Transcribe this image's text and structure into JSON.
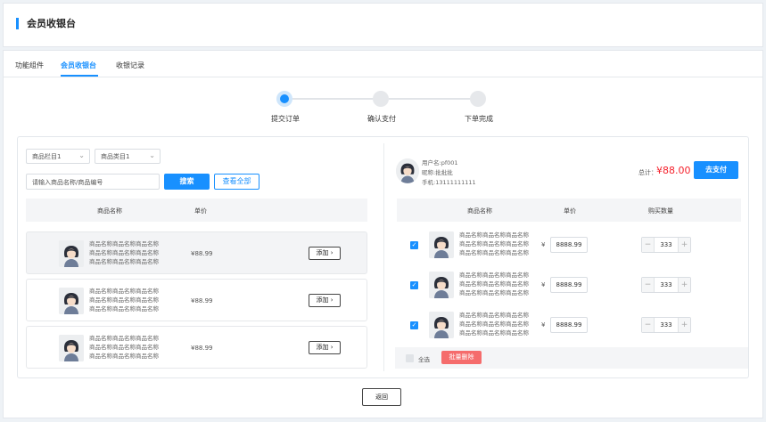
{
  "page": {
    "title": "会员收银台"
  },
  "tabs": [
    {
      "label": "功能组件"
    },
    {
      "label": "会员收银台"
    },
    {
      "label": "收银记录"
    }
  ],
  "steps": [
    {
      "label": "提交订单",
      "active": true
    },
    {
      "label": "确认支付",
      "active": false
    },
    {
      "label": "下单完成",
      "active": false
    }
  ],
  "filters": {
    "column_select": "商品栏目1",
    "category_select": "商品类目1",
    "search_placeholder": "请输入商品名称/商品编号",
    "search_label": "搜索",
    "view_all_label": "查看全部"
  },
  "product_table": {
    "headers": [
      "商品名称",
      "单价"
    ],
    "rows": [
      {
        "name": "商品名称商品名称商品名称商品名称商品名称商品名称商品名称商品名称商品名称",
        "price": "¥88.99",
        "add_label": "添加"
      },
      {
        "name": "商品名称商品名称商品名称商品名称商品名称商品名称商品名称商品名称商品名称",
        "price": "¥88.99",
        "add_label": "添加"
      },
      {
        "name": "商品名称商品名称商品名称商品名称商品名称商品名称商品名称商品名称商品名称",
        "price": "¥88.99",
        "add_label": "添加"
      }
    ]
  },
  "member": {
    "username": "用户名:pf001",
    "nickname": "昵称:批批批",
    "phone": "手机:13111111111"
  },
  "order": {
    "total_label": "总计：",
    "total_value": "¥88.00",
    "pay_label": "去支付"
  },
  "cart_table": {
    "headers": [
      "商品名称",
      "单价",
      "购买数量"
    ],
    "rows": [
      {
        "name": "商品名称商品名称商品名称商品名称商品名称商品名称商品名称商品名称商品名称",
        "currency": "¥",
        "price": "8888.99",
        "qty": "333",
        "checked": true
      },
      {
        "name": "商品名称商品名称商品名称商品名称商品名称商品名称商品名称商品名称商品名称",
        "currency": "¥",
        "price": "8888.99",
        "qty": "333",
        "checked": true
      },
      {
        "name": "商品名称商品名称商品名称商品名称商品名称商品名称商品名称商品名称商品名称",
        "currency": "¥",
        "price": "8888.99",
        "qty": "333",
        "checked": true
      }
    ]
  },
  "cart_footer": {
    "select_all_label": "全选",
    "batch_delete_label": "批量删除"
  },
  "back_label": "返回",
  "colors": {
    "primary": "#1890ff",
    "danger": "#f56c6c",
    "price": "#f5222d"
  },
  "icons": {
    "select": "chevron-down-icon",
    "add": "chevron-right-icon",
    "check": "check-icon"
  }
}
